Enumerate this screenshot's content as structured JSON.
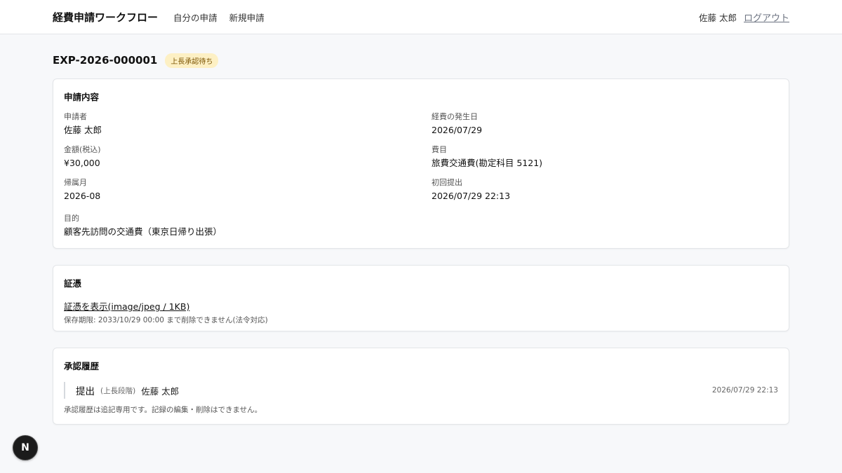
{
  "header": {
    "brand": "経費申請ワークフロー",
    "nav": [
      "自分の申請",
      "新規申請"
    ],
    "user_name": "佐藤 太郎",
    "logout": "ログアウト"
  },
  "request": {
    "id": "EXP-2026-000001",
    "status": "上長承認待ち"
  },
  "details": {
    "title": "申請内容",
    "applicant_label": "申請者",
    "applicant": "佐藤 太郎",
    "expense_date_label": "経費の発生日",
    "expense_date": "2026/07/29",
    "amount_label": "金額(税込)",
    "amount": "¥30,000",
    "category_label": "費目",
    "category": "旅費交通費(勘定科目 5121)",
    "period_label": "帰属月",
    "period": "2026-08",
    "first_submitted_label": "初回提出",
    "first_submitted": "2026/07/29 22:13",
    "purpose_label": "目的",
    "purpose": "顧客先訪問の交通費（東京日帰り出張）"
  },
  "receipt": {
    "title": "証憑",
    "link": "証憑を表示(image/jpeg / 1KB)",
    "retention": "保存期限: 2033/10/29 00:00 まで削除できません(法令対応)"
  },
  "history": {
    "title": "承認履歴",
    "entries": [
      {
        "action": "提出",
        "stage": "(上長段階)",
        "user": "佐藤 太郎",
        "time": "2026/07/29 22:13"
      }
    ],
    "note": "承認履歴は追記専用です。記録の編集・削除はできません。"
  },
  "dev_indicator": {
    "letter": "N"
  },
  "colors": {
    "badge_bg": "#fdf0c4",
    "badge_text": "#7a5200",
    "page_bg": "#f7f8fa"
  }
}
